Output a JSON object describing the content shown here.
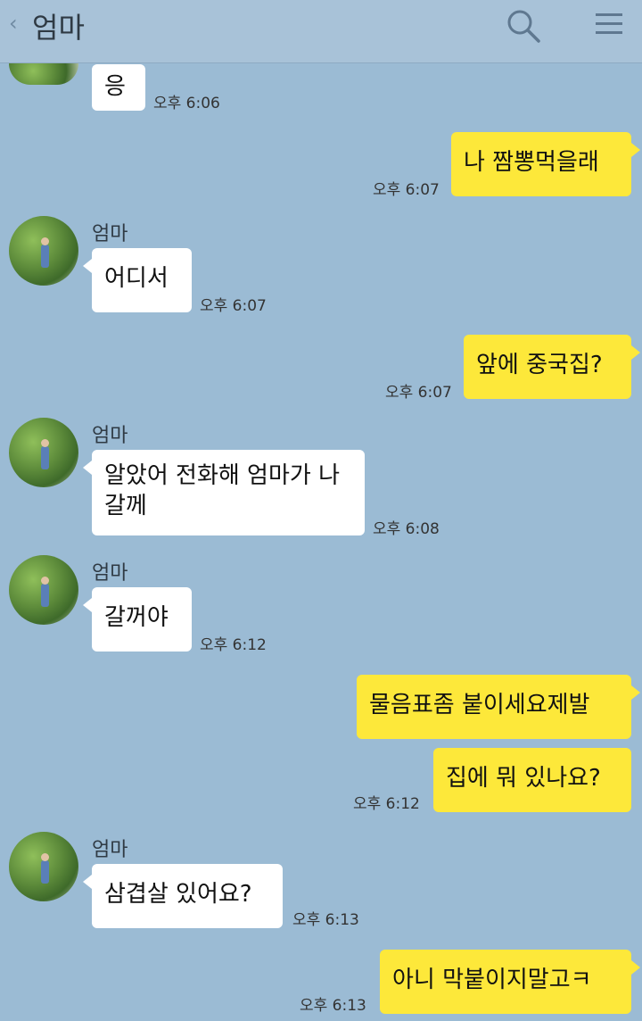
{
  "header": {
    "title": "엄마",
    "back_icon": "chevron-left-icon",
    "search_icon": "search-icon",
    "menu_icon": "hamburger-menu-icon"
  },
  "colors": {
    "background": "#9bbbd4",
    "incoming_bubble": "#ffffff",
    "outgoing_bubble": "#fde83a"
  },
  "messages": [
    {
      "sender": "",
      "text": "응",
      "time": "오후 6:06"
    },
    {
      "sender": "me",
      "text": "나 짬뽕먹을래",
      "time": "오후 6:07"
    },
    {
      "sender": "엄마",
      "text": "어디서",
      "time": "오후 6:07"
    },
    {
      "sender": "me",
      "text": "앞에 중국집?",
      "time": "오후 6:07"
    },
    {
      "sender": "엄마",
      "text": "알았어 전화해 엄마가 나갈께",
      "time": "오후 6:08"
    },
    {
      "sender": "엄마",
      "text": "갈꺼야",
      "time": "오후 6:12"
    },
    {
      "sender": "me",
      "text": "물음표좀 붙이세요제발",
      "time": ""
    },
    {
      "sender": "me",
      "text": "집에 뭐 있나요?",
      "time": "오후 6:12"
    },
    {
      "sender": "엄마",
      "text": "삼겹살 있어요?",
      "time": "오후 6:13"
    },
    {
      "sender": "me",
      "text": "아니 막붙이지말고ㅋ",
      "time": "오후 6:13"
    }
  ]
}
